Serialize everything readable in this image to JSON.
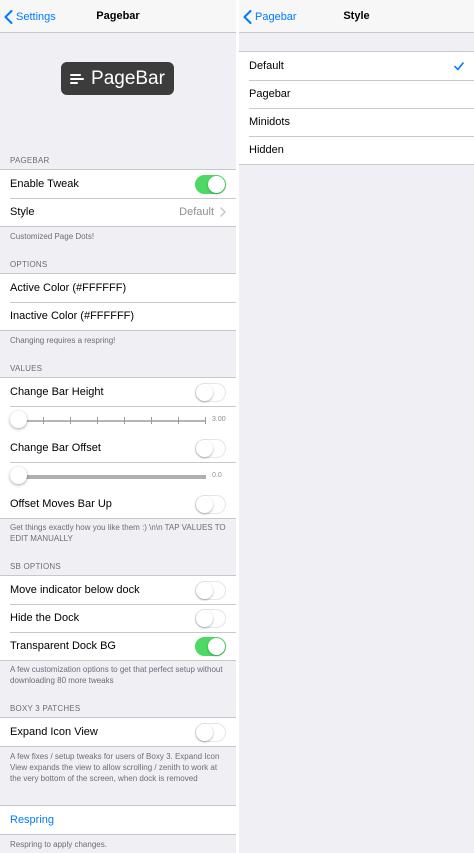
{
  "left": {
    "nav": {
      "back_label": "Settings",
      "title": "Pagebar"
    },
    "logo_text": "PageBar",
    "pagebar_section": {
      "header": "PAGEBAR",
      "enable_tweak": {
        "label": "Enable Tweak",
        "on": true
      },
      "style": {
        "label": "Style",
        "value": "Default"
      },
      "footer": "Customized Page Dots!"
    },
    "options_section": {
      "header": "OPTIONS",
      "active_color": "Active Color (#FFFFFF)",
      "inactive_color": "Inactive Color (#FFFFFF)",
      "footer": "Changing requires a respring!"
    },
    "values_section": {
      "header": "VALUES",
      "change_bar_height": {
        "label": "Change Bar Height",
        "on": false
      },
      "height_slider": {
        "value": 0,
        "max": 3,
        "value_label": "3.00"
      },
      "change_bar_offset": {
        "label": "Change Bar Offset",
        "on": false
      },
      "offset_slider": {
        "value": 0,
        "value_label": "0.0"
      },
      "offset_moves_up": {
        "label": "Offset Moves Bar Up",
        "on": false
      },
      "footer": "Get things exactly how you like them :) \\n\\n TAP VALUES TO EDIT MANUALLY"
    },
    "sb_section": {
      "header": "SB OPTIONS",
      "move_indicator": {
        "label": "Move indicator below dock",
        "on": false
      },
      "hide_dock": {
        "label": "Hide the Dock",
        "on": false
      },
      "transparent_dock": {
        "label": "Transparent Dock BG",
        "on": true
      },
      "footer": "A few customization options to get that perfect setup without downloading 80 more tweaks"
    },
    "boxy_section": {
      "header": "BOXY 3 PATCHES",
      "expand_icon_view": {
        "label": "Expand Icon View",
        "on": false
      },
      "footer": "A few fixes / setup tweaks for users of Boxy 3. Expand Icon View expands the view to allow scrolling / zenith to work at the very bottom of the screen, when dock is removed"
    },
    "respring": {
      "label": "Respring",
      "footer": "Respring to apply changes."
    }
  },
  "right": {
    "nav": {
      "back_label": "Pagebar",
      "title": "Style"
    },
    "options": [
      {
        "label": "Default",
        "selected": true
      },
      {
        "label": "Pagebar",
        "selected": false
      },
      {
        "label": "Minidots",
        "selected": false
      },
      {
        "label": "Hidden",
        "selected": false
      }
    ]
  },
  "colors": {
    "accent": "#007aff",
    "toggle_on": "#4cd964",
    "background": "#efeff4",
    "secondary_text": "#6d6d72"
  }
}
